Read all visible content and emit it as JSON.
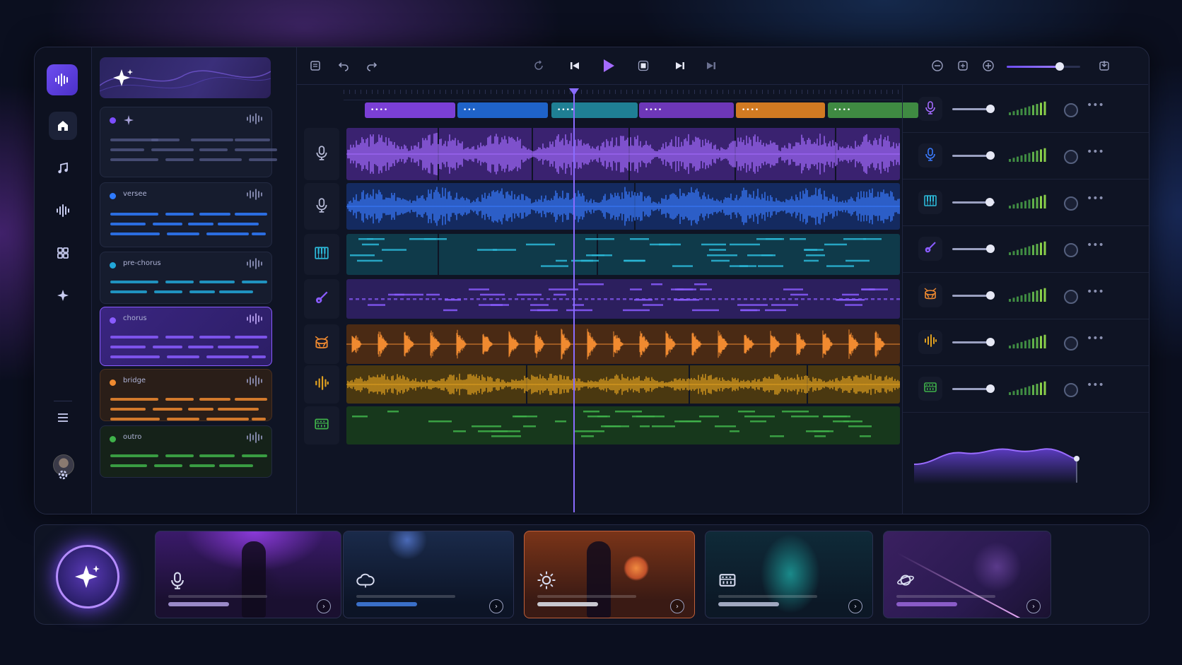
{
  "app": {
    "title": "",
    "rail": {
      "logo_icon": "waveform-logo-icon",
      "items": [
        {
          "icon": "home-icon",
          "active": true
        },
        {
          "icon": "music-note-icon",
          "active": false
        },
        {
          "icon": "waveform-icon",
          "active": false
        },
        {
          "icon": "grid-icon",
          "active": false
        },
        {
          "icon": "sparkle-icon",
          "active": false
        }
      ],
      "bottom_items": [
        "menu-icon",
        "avatar",
        "gear-icon"
      ]
    },
    "sections": {
      "hero_icon": "sparkle-icon",
      "cards": [
        {
          "label": "",
          "color": "#7c4dff",
          "selected": false
        },
        {
          "label": "versee",
          "color": "#2f7bff",
          "selected": false
        },
        {
          "label": "pre-chorus",
          "color": "#22a7d8",
          "selected": false
        },
        {
          "label": "chorus",
          "color": "#8a5cff",
          "selected": true
        },
        {
          "label": "bridge",
          "color": "#f08a30",
          "selected": false
        },
        {
          "label": "outro",
          "color": "#3fb24a",
          "selected": false
        }
      ]
    },
    "transport": {
      "left_icons": [
        "panel-icon",
        "undo-icon",
        "redo-icon"
      ],
      "center_icons": [
        "loop-icon",
        "skip-back-icon",
        "play-icon",
        "stop-icon",
        "skip-forward-icon",
        "skip-end-icon"
      ],
      "right_icons": [
        "zoom-out-icon",
        "clip-icon",
        "zoom-in-icon",
        "export-icon"
      ],
      "zoom_level": 0.72
    },
    "arrangement": {
      "segments": [
        {
          "color": "#7b3fd6",
          "dots": "••••"
        },
        {
          "color": "#1f63c9",
          "dots": "•••"
        },
        {
          "color": "#1f7f94",
          "dots": "••••"
        },
        {
          "color": "#6d37b8",
          "dots": "••••"
        },
        {
          "color": "#d17a22",
          "dots": "••••"
        },
        {
          "color": "#3f8a42",
          "dots": "••••"
        }
      ],
      "playhead_fraction": 0.41
    },
    "tracks": [
      {
        "icon": "microphone-icon",
        "kind": "vocal",
        "color": "#a46bff",
        "bg": "#3a2270"
      },
      {
        "icon": "microphone-icon",
        "kind": "vocal",
        "color": "#3a7bff",
        "bg": "#142a60"
      },
      {
        "icon": "piano-icon",
        "kind": "midi",
        "color": "#2cb8d8",
        "bg": "#0f3a4a"
      },
      {
        "icon": "guitar-icon",
        "kind": "midi",
        "color": "#8a5cff",
        "bg": "#2c1f5e"
      },
      {
        "icon": "drum-icon",
        "kind": "drum",
        "color": "#f08a30",
        "bg": "#4a2a14"
      },
      {
        "icon": "waveform-icon",
        "kind": "audio",
        "color": "#e0a020",
        "bg": "#4a3810"
      },
      {
        "icon": "synth-icon",
        "kind": "midi",
        "color": "#3fb24a",
        "bg": "#17381c"
      }
    ],
    "mixer": {
      "channels": [
        {
          "icon": "microphone-icon",
          "color": "#a46bff",
          "volume": 0.9
        },
        {
          "icon": "microphone-icon",
          "color": "#3a7bff",
          "volume": 0.9
        },
        {
          "icon": "piano-icon",
          "color": "#2cb8d8",
          "volume": 0.88
        },
        {
          "icon": "guitar-icon",
          "color": "#8a5cff",
          "volume": 0.9
        },
        {
          "icon": "drum-icon",
          "color": "#f08a30",
          "volume": 0.9
        },
        {
          "icon": "waveform-icon",
          "color": "#e0a020",
          "volume": 0.9
        },
        {
          "icon": "synth-icon",
          "color": "#3fb24a",
          "volume": 0.9
        }
      ]
    },
    "presets": [
      {
        "icon": "microphone-icon",
        "accent": "#9a8ac8"
      },
      {
        "icon": "cloud-icon",
        "accent": "#3a6fc8"
      },
      {
        "icon": "sun-icon",
        "accent": "#c8c8d0"
      },
      {
        "icon": "synth-icon",
        "accent": "#a0a8c0"
      },
      {
        "icon": "planet-icon",
        "accent": "#8a5cc8"
      }
    ]
  }
}
